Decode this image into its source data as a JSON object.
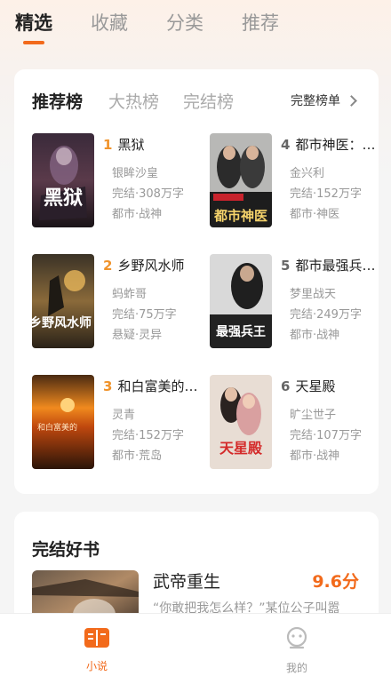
{
  "top_tabs": [
    {
      "label": "精选",
      "active": true
    },
    {
      "label": "收藏",
      "active": false
    },
    {
      "label": "分类",
      "active": false
    },
    {
      "label": "推荐",
      "active": false
    }
  ],
  "rank": {
    "tabs": [
      {
        "label": "推荐榜",
        "active": true
      },
      {
        "label": "大热榜",
        "active": false
      },
      {
        "label": "完结榜",
        "active": false
      }
    ],
    "full_list_label": "完整榜单",
    "books": [
      {
        "rank": "1",
        "title": "黑狱",
        "author": "银眸沙皇",
        "status": "完结·308万字",
        "tags": "都市·战神"
      },
      {
        "rank": "4",
        "title": "都市神医：…",
        "author": "金兴利",
        "status": "完结·152万字",
        "tags": "都市·神医"
      },
      {
        "rank": "2",
        "title": "乡野风水师",
        "author": "蚂蚱哥",
        "status": "完结·75万字",
        "tags": "悬疑·灵异"
      },
      {
        "rank": "5",
        "title": "都市最强兵…",
        "author": "梦里战天",
        "status": "完结·249万字",
        "tags": "都市·战神"
      },
      {
        "rank": "3",
        "title": "和白富美的…",
        "author": "灵青",
        "status": "完结·152万字",
        "tags": "都市·荒岛"
      },
      {
        "rank": "6",
        "title": "天星殿",
        "author": "旷尘世子",
        "status": "完结·107万字",
        "tags": "都市·战神"
      }
    ],
    "cover_texts": [
      "黑狱",
      "都市神医",
      "乡野风水师",
      "最强兵王",
      "和白富美的",
      "天星殿"
    ]
  },
  "finished": {
    "title": "完结好书",
    "book_title": "武帝重生",
    "score": "9.6分",
    "desc": "“你敢把我怎么样？”某位公子叫嚣"
  },
  "bottom_nav": [
    {
      "label": "小说",
      "active": true,
      "icon": "book-icon"
    },
    {
      "label": "我的",
      "active": false,
      "icon": "profile-icon"
    }
  ],
  "colors": {
    "accent": "#f26a1b",
    "rank_hot": "#f0932b"
  }
}
